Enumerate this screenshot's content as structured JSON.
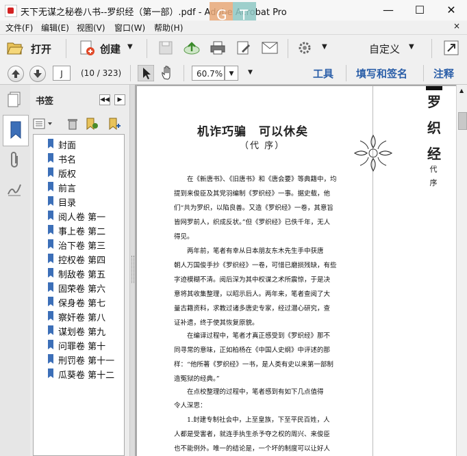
{
  "window": {
    "title": "天下无谋之秘卷八书--罗织经（第一部）.pdf - Adobe Acrobat Pro",
    "minimize": "—",
    "maximize": "☐",
    "close": "✕"
  },
  "menu": {
    "items": [
      "文件(F)",
      "编辑(E)",
      "视图(V)",
      "窗口(W)",
      "帮助(H)"
    ],
    "close": "×"
  },
  "toolbar": {
    "open_label": "打开",
    "create_label": "创建",
    "customize_label": "自定义"
  },
  "nav": {
    "page_input": "J",
    "page_count": "(10 / 323)",
    "zoom": "60.7%",
    "tools_label": "工具",
    "fill_sign_label": "填写和签名",
    "comment_label": "注释"
  },
  "bookmarks": {
    "title": "书签",
    "items": [
      "封面",
      "书名",
      "版权",
      "前言",
      "目录",
      "阅人卷 第一",
      "事上卷 第二",
      "治下卷 第三",
      "控权卷 第四",
      "制敌卷 第五",
      "固荣卷 第六",
      "保身卷 第七",
      "察奸卷 第八",
      "谋划卷 第九",
      "问罪卷 第十",
      "刑罚卷 第十一",
      "瓜葵卷 第十二"
    ]
  },
  "document": {
    "title": "机诈巧骗　可以休矣",
    "subtitle": "（代 序）",
    "side_title": [
      "罗",
      "织",
      "经"
    ],
    "side_sub": [
      "代",
      "序"
    ],
    "lines": [
      "在《新唐书》、《旧唐书》和《唐会要》等典籍中，均",
      "提到来俊臣及其党羽编制《罗织经》一事。据史载，他",
      "们“共为罗织，以陷良善。又造《罗织经》一卷，其意旨",
      "皆网罗前人，织成反状。”但《罗织经》已佚千年，无人",
      "得见。",
      "两年前，笔者有幸从日本朋友东木先生手中获唐",
      "朝人万国俊手抄《罗织经》一卷，可惜已磨损残缺，有些",
      "字迹模糊不清。阅后深为其中权谋之术所震惊，于是决",
      "意将其收集整理，以昭示后人。两年来，笔者查阅了大",
      "量古籍资料，求教过诸多唐史专家，经过潜心研究，查",
      "证补遗，终于使其恢复原貌。",
      "在编译过程中，笔者才真正感受到《罗织经》那不",
      "同寻常的意味，正如柏杨在《中国人史纲》中评述的那",
      "样：“他所著《罗织经》一书，是人类有史以来第一部制",
      "造冤狱的经典。”",
      "在点校整理的过程中，笔者感到有如下几点值得",
      "令人深思：",
      "1.封建专制社会中，上至皇族，下至平民百姓，人",
      "人都是受害者，就连手执生杀予夺之权的周兴、来俊臣",
      "也不能例外。唯一的结论是，一个坏的制度可以让好人"
    ]
  }
}
